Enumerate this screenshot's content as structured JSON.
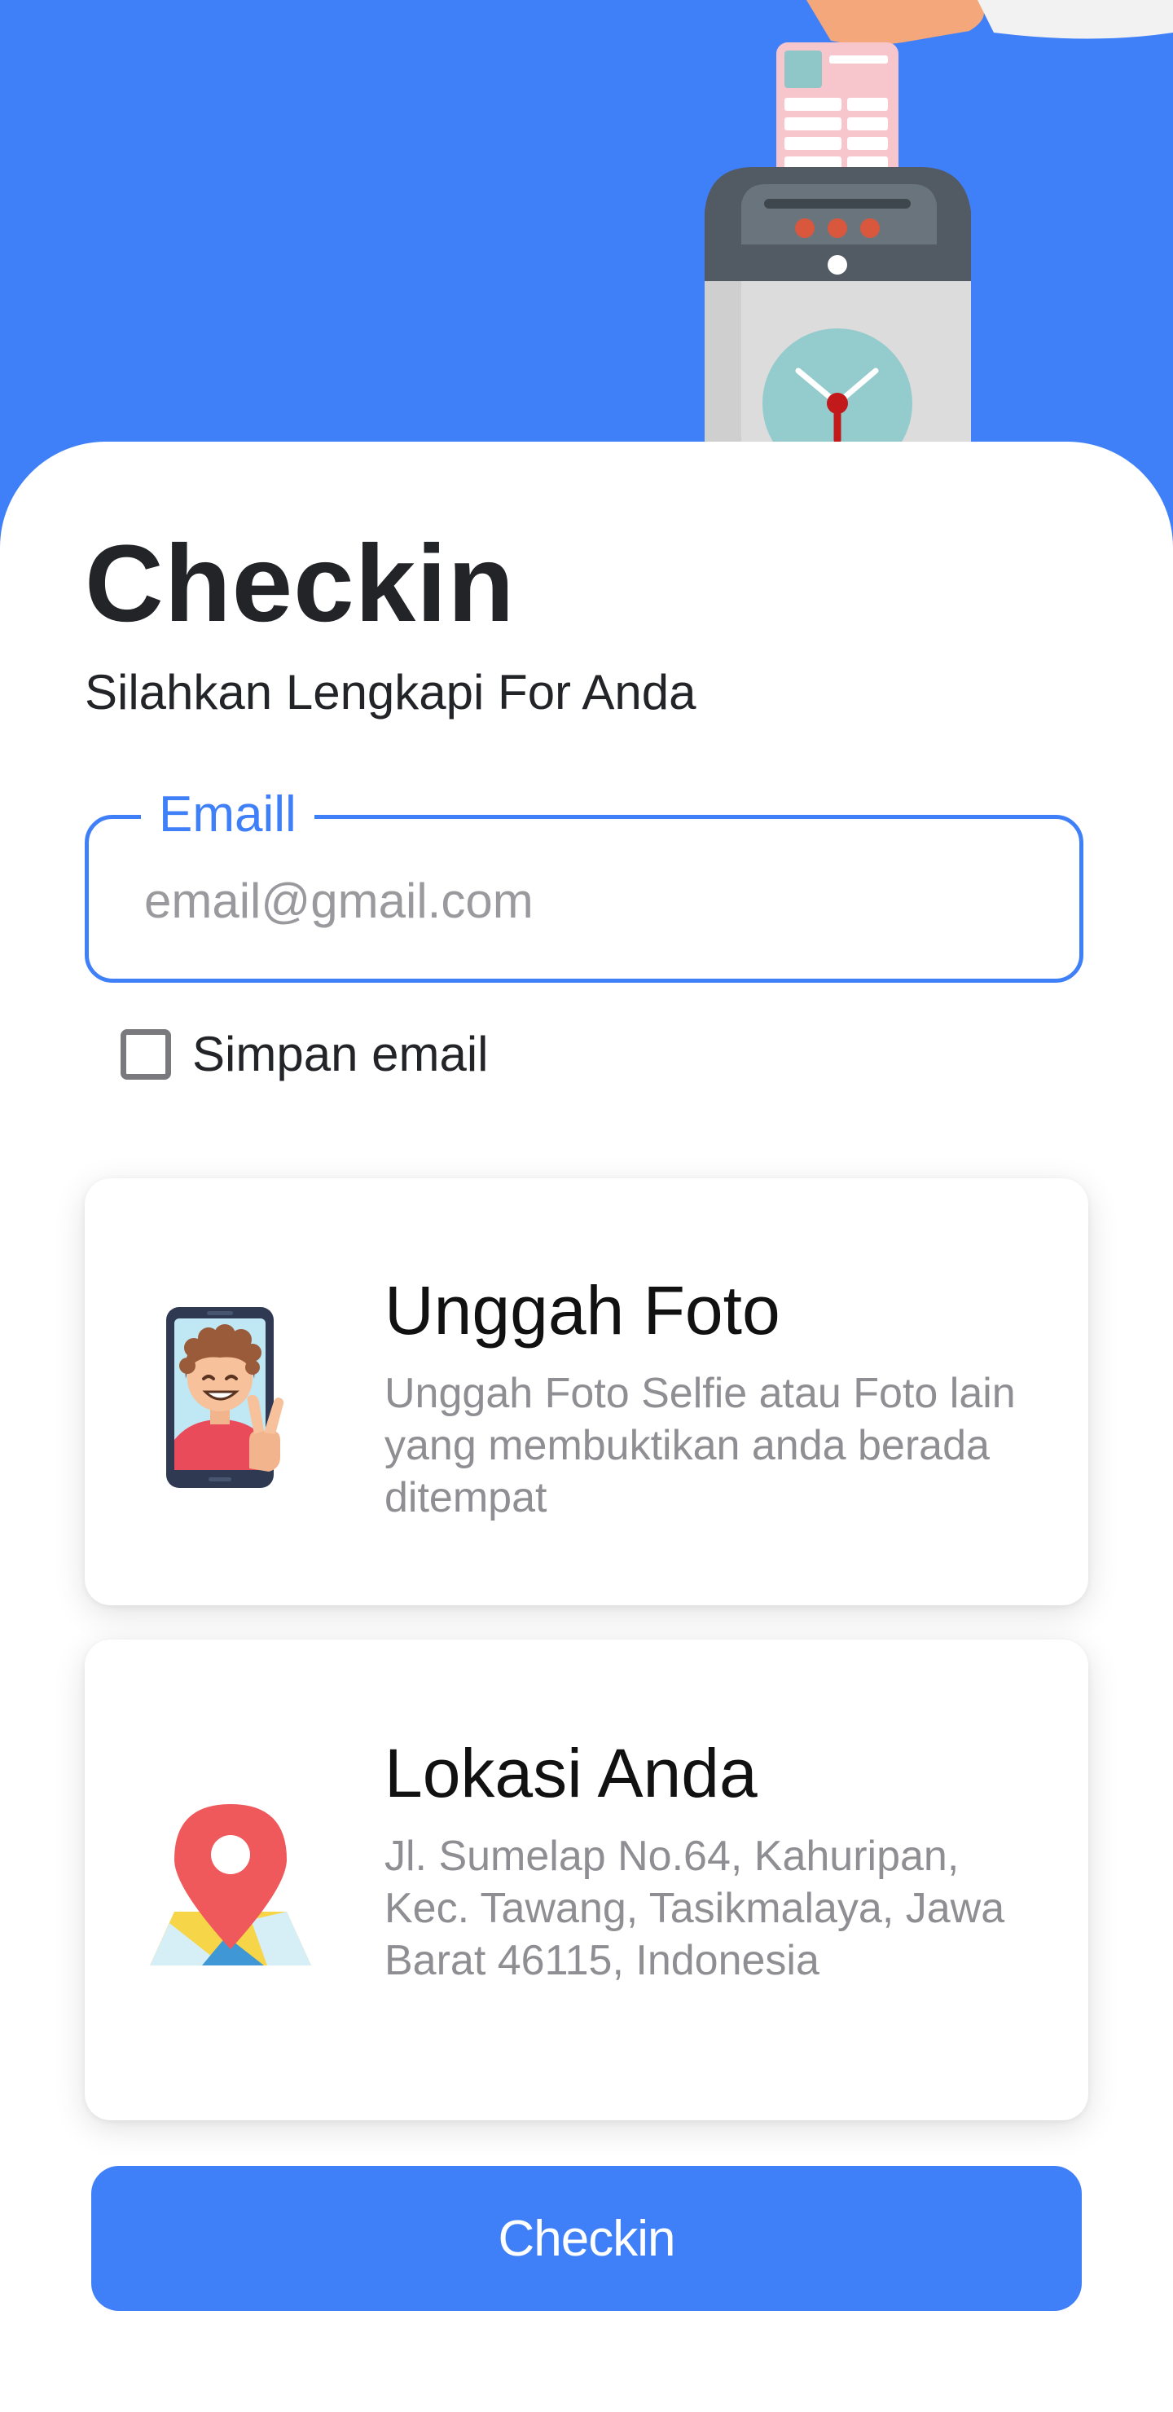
{
  "header": {
    "illustration_icon": "time-clock-punch-card-icon",
    "colors": {
      "primary": "#3f80f9",
      "background": "#ffffff"
    }
  },
  "form": {
    "title": "Checkin",
    "subtitle": "Silahkan Lengkapi For Anda",
    "email": {
      "label": "Emaill",
      "placeholder": "email@gmail.com",
      "value": ""
    },
    "remember": {
      "label": "Simpan email",
      "checked": false
    }
  },
  "cards": {
    "photo": {
      "icon": "selfie-phone-icon",
      "title": "Unggah Foto",
      "description": "Unggah Foto Selfie atau Foto lain yang membuktikan anda berada ditempat"
    },
    "location": {
      "icon": "map-pin-icon",
      "title": "Lokasi Anda",
      "address": "Jl. Sumelap No.64, Kahuripan, Kec. Tawang, Tasikmalaya, Jawa Barat 46115, Indonesia"
    }
  },
  "actions": {
    "checkin_label": "Checkin"
  }
}
